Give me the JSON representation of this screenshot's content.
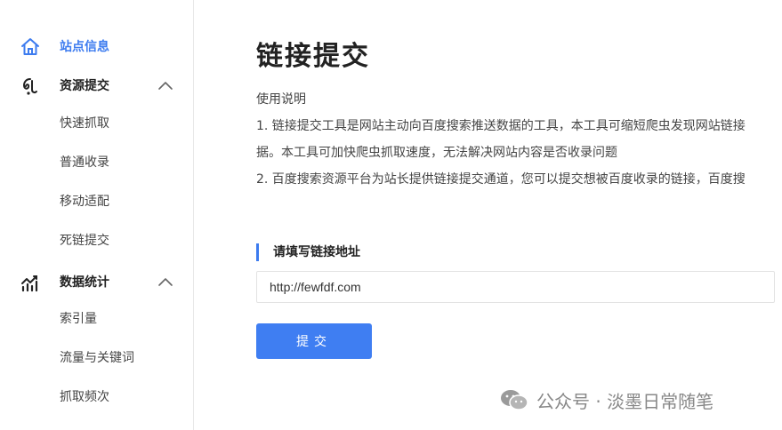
{
  "sidebar": {
    "groups": [
      {
        "label": "站点信息",
        "icon": "home-icon",
        "active": true
      },
      {
        "label": "资源提交",
        "icon": "resource-submit-icon",
        "expanded": true,
        "items": [
          "快速抓取",
          "普通收录",
          "移动适配",
          "死链提交"
        ]
      },
      {
        "label": "数据统计",
        "icon": "data-stats-icon",
        "expanded": true,
        "items": [
          "索引量",
          "流量与关键词",
          "抓取频次"
        ]
      }
    ]
  },
  "main": {
    "title": "链接提交",
    "intro_heading": "使用说明",
    "intro_lines": [
      "1. 链接提交工具是网站主动向百度搜索推送数据的工具，本工具可缩短爬虫发现网站链接",
      "据。本工具可加快爬虫抓取速度，无法解决网站内容是否收录问题",
      "2. 百度搜索资源平台为站长提供链接提交通道，您可以提交想被百度收录的链接，百度搜"
    ],
    "section_label": "请填写链接地址",
    "url_value": "http://fewfdf.com",
    "submit_label": "提交"
  },
  "watermark": {
    "text": "公众号 · 淡墨日常随笔"
  },
  "colors": {
    "accent": "#3c7bef",
    "button": "#3f7ef2"
  }
}
